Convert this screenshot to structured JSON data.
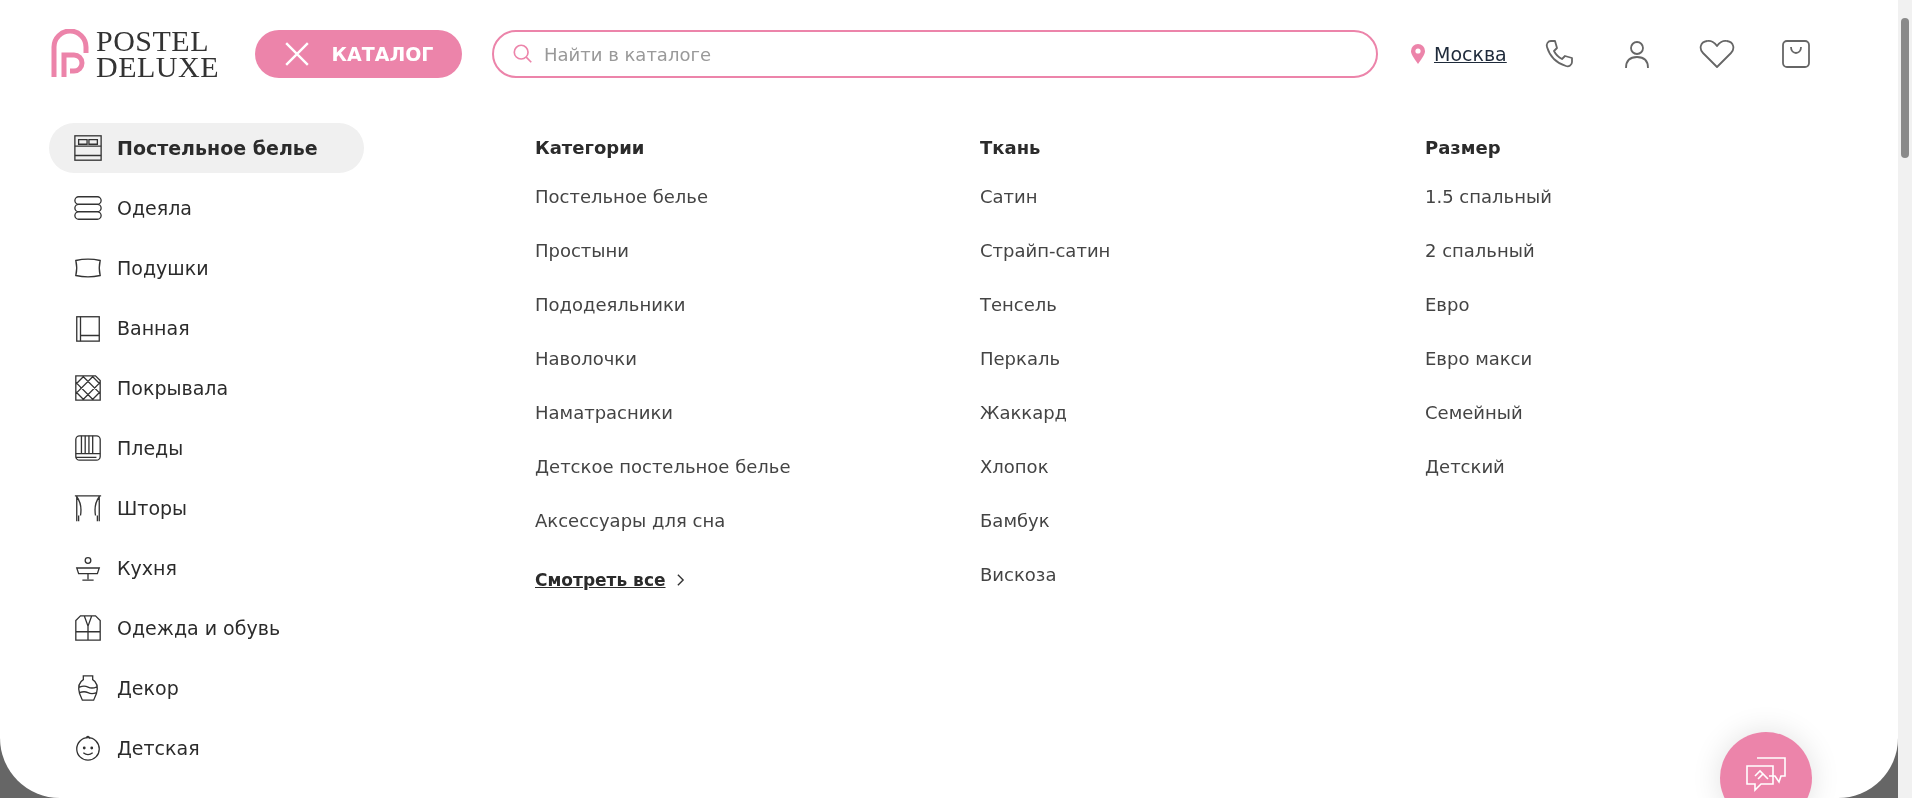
{
  "header": {
    "logo": [
      "POSTEL",
      "DELUXE"
    ],
    "catalog_button": "КАТАЛОГ",
    "search": {
      "placeholder": "Найти в каталоге"
    },
    "city": "Москва"
  },
  "sidebar": {
    "items": [
      {
        "label": "Постельное белье",
        "selected": true
      },
      {
        "label": "Одеяла",
        "selected": false
      },
      {
        "label": "Подушки",
        "selected": false
      },
      {
        "label": "Ванная",
        "selected": false
      },
      {
        "label": "Покрывала",
        "selected": false
      },
      {
        "label": "Пледы",
        "selected": false
      },
      {
        "label": "Шторы",
        "selected": false
      },
      {
        "label": "Кухня",
        "selected": false
      },
      {
        "label": "Одежда и обувь",
        "selected": false
      },
      {
        "label": "Декор",
        "selected": false
      },
      {
        "label": "Детская",
        "selected": false
      }
    ]
  },
  "columns": [
    {
      "title": "Категории",
      "items": [
        "Постельное белье",
        "Простыни",
        "Пододеяльники",
        "Наволочки",
        "Наматрасники",
        "Детское постельное белье",
        "Аксессуары для сна"
      ],
      "link": "Смотреть все"
    },
    {
      "title": "Ткань",
      "items": [
        "Сатин",
        "Страйп-сатин",
        "Тенсель",
        "Перкаль",
        "Жаккард",
        "Хлопок",
        "Бамбук",
        "Вискоза"
      ]
    },
    {
      "title": "Размер",
      "items": [
        "1.5 спальный",
        "2 спальный",
        "Евро",
        "Евро макси",
        "Семейный",
        "Детский"
      ]
    }
  ]
}
